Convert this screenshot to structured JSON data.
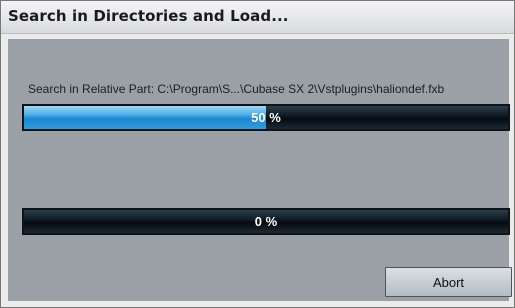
{
  "window": {
    "title": "Search in Directories and Load..."
  },
  "status": {
    "path_text": "Search in Relative Part: C:\\Program\\S...\\Cubase SX 2\\Vstplugins\\haliondef.fxb"
  },
  "progress_bars": [
    {
      "label": "50 %",
      "value": 0.5
    },
    {
      "label": "0 %",
      "value": 0.0
    }
  ],
  "buttons": {
    "abort_label": "Abort"
  },
  "colors": {
    "content_bg": "#9aa0a5",
    "progress_fill": "#2f9ee0",
    "progress_track": "#0d1821"
  }
}
